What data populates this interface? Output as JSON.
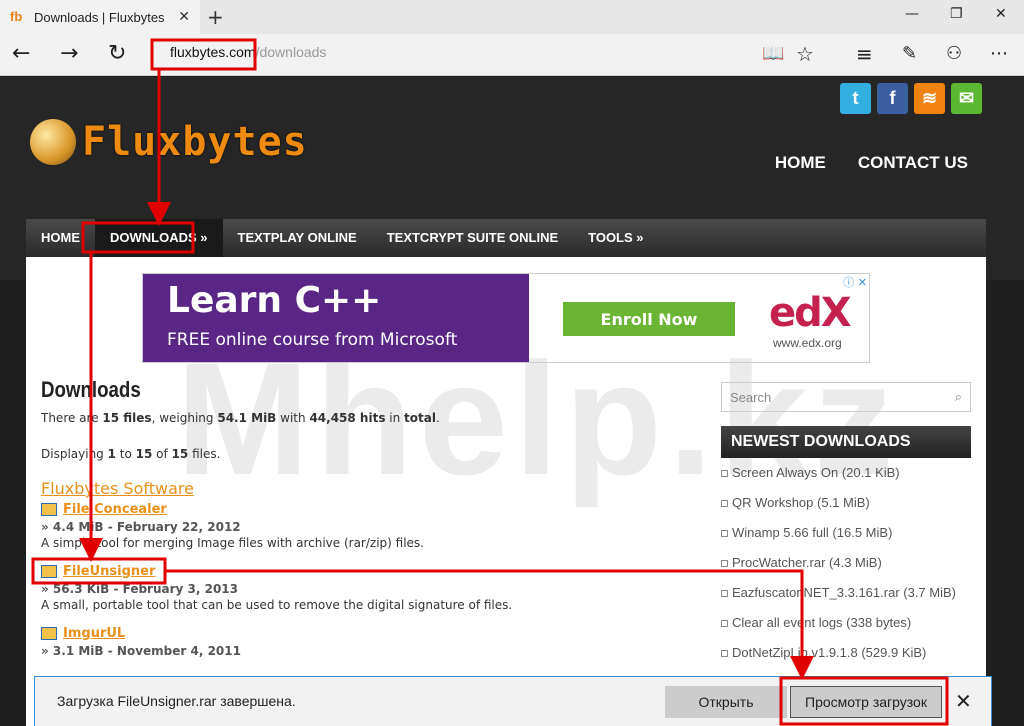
{
  "browser": {
    "tab_title": "Downloads | Fluxbytes",
    "tab_favicon": "fb",
    "url_host": "fluxbytes.com",
    "url_path": "/downloads"
  },
  "site": {
    "logo_text": "Fluxbytes",
    "top_nav": [
      "HOME",
      "CONTACT US"
    ],
    "menu": [
      "HOME",
      "DOWNLOADS  »",
      "TEXTPLAY ONLINE",
      "TEXTCRYPT SUITE ONLINE",
      "TOOLS  »"
    ],
    "social": [
      {
        "name": "twitter-icon",
        "glyph": "t",
        "color": "#33aee0"
      },
      {
        "name": "facebook-icon",
        "glyph": "f",
        "color": "#3b5fa0"
      },
      {
        "name": "rss-icon",
        "glyph": "≋",
        "color": "#f0830f"
      },
      {
        "name": "mail-icon",
        "glyph": "✉",
        "color": "#5cb833"
      }
    ]
  },
  "ad": {
    "title": "Learn C++",
    "subtitle": "FREE online course from Microsoft",
    "button": "Enroll Now",
    "brand": "edX",
    "brand_url": "www.edx.org"
  },
  "watermark": "Mhelp.kz",
  "downloads": {
    "title": "Downloads",
    "stat1": {
      "a": "There are ",
      "files": "15 files",
      "b": ", weighing ",
      "size": "54.1 MiB",
      "c": " with ",
      "hits": "44,458 hits",
      "d": " in ",
      "total": "total",
      "e": "."
    },
    "stat2": {
      "a": "Displaying ",
      "from": "1",
      "b": " to ",
      "to": "15",
      "c": " of ",
      "count": "15",
      "d": " files."
    },
    "section": "Fluxbytes Software",
    "entries": [
      {
        "name": "File Concealer",
        "meta": "» 4.4 MiB - February 22, 2012",
        "desc": "A simple tool for merging Image files with archive (rar/zip) files."
      },
      {
        "name": "FileUnsigner",
        "meta": "» 56.3 KiB - February 3, 2013",
        "desc": "A small, portable tool that can be used to remove the digital signature of files."
      },
      {
        "name": "ImgurUL",
        "meta": "» 3.1 MiB - November 4, 2011",
        "desc": ""
      }
    ]
  },
  "sidebar": {
    "search_placeholder": "Search",
    "newest_title": "NEWEST DOWNLOADS",
    "items": [
      "Screen Always On (20.1 KiB)",
      "QR Workshop (5.1 MiB)",
      "Winamp 5.66 full (16.5 MiB)",
      "ProcWatcher.rar (4.3 MiB)",
      "Eazfuscator.NET_3.3.161.rar (3.7 MiB)",
      "Clear all event logs (338 bytes)",
      "DotNetZipLib.v1.9.1.8 (529.9 KiB)"
    ]
  },
  "download_bar": {
    "message": "Загрузка FileUnsigner.rar завершена.",
    "open": "Открыть",
    "view": "Просмотр загрузок"
  },
  "colors": {
    "annotation": "#e00000",
    "accent": "#e8901a"
  }
}
